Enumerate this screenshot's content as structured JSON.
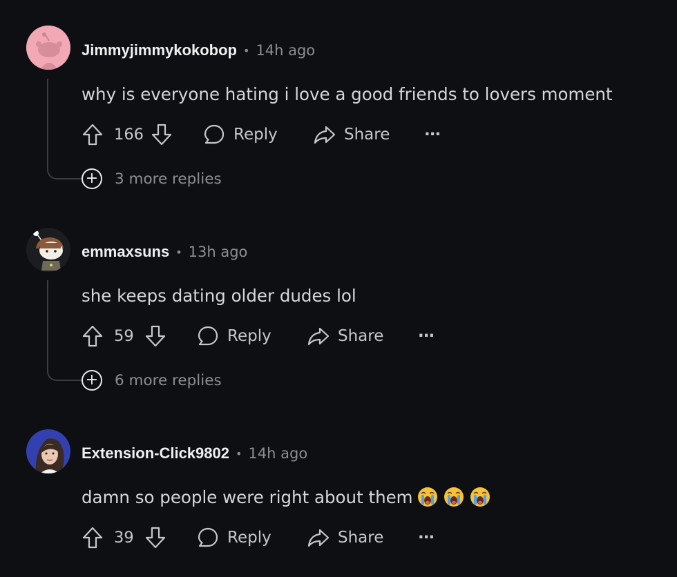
{
  "comments": [
    {
      "username": "Jimmyjimmykokobop",
      "separator": "•",
      "time": "14h ago",
      "text": "why is everyone hating i love a good friends to lovers moment",
      "votes": "166",
      "reply_label": "Reply",
      "share_label": "Share",
      "more_label": "···",
      "more_replies": "3 more replies"
    },
    {
      "username": "emmaxsuns",
      "separator": "•",
      "time": "13h ago",
      "text": "she keeps dating older dudes lol",
      "votes": "59",
      "reply_label": "Reply",
      "share_label": "Share",
      "more_label": "···",
      "more_replies": "6 more replies"
    },
    {
      "username": "Extension-Click9802",
      "separator": "•",
      "time": "14h ago",
      "text": "damn so people were right about them",
      "emojis": [
        "loudly-crying-face",
        "loudly-crying-face",
        "loudly-crying-face"
      ],
      "votes": "39",
      "reply_label": "Reply",
      "share_label": "Share",
      "more_label": "···"
    }
  ],
  "colors": {
    "background": "#0e0f12",
    "username": "#eef0f2",
    "muted": "#8b8f94",
    "body": "#d4d7dc",
    "thread_line": "#3a3d42"
  }
}
